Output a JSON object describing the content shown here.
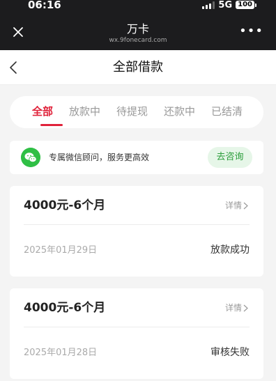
{
  "status_bar": {
    "time": "06:16",
    "network": "5G",
    "battery": "100"
  },
  "wx_header": {
    "title": "万卡",
    "subtitle": "wx.9fonecard.com",
    "more": "•••"
  },
  "page": {
    "title": "全部借款"
  },
  "tabs": [
    {
      "label": "全部",
      "active": true
    },
    {
      "label": "放款中",
      "active": false
    },
    {
      "label": "待提现",
      "active": false
    },
    {
      "label": "还款中",
      "active": false
    },
    {
      "label": "已结清",
      "active": false
    }
  ],
  "advisor": {
    "text": "专属微信顾问，服务更高效",
    "button": "去咨询"
  },
  "loans": [
    {
      "amount": "4000元-6个月",
      "detail": "详情",
      "date": "2025年01月29日",
      "status": "放款成功"
    },
    {
      "amount": "4000元-6个月",
      "detail": "详情",
      "date": "2025年01月28日",
      "status": "审核失败"
    }
  ],
  "colors": {
    "accent": "#e0223a",
    "wechat_green": "#2fbf45",
    "header_dark": "#1c1c1e"
  }
}
